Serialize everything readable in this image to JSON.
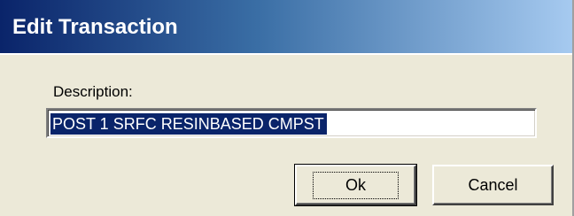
{
  "dialog": {
    "title": "Edit Transaction",
    "description_label": "Description:",
    "description_value": "POST 1 SRFC RESINBASED CMPST",
    "ok_label": "Ok",
    "cancel_label": "Cancel"
  },
  "colors": {
    "titlebar_start": "#0a246a",
    "titlebar_end": "#a6caf0",
    "dialog_face": "#ece9d8",
    "selection": "#0a246a"
  }
}
